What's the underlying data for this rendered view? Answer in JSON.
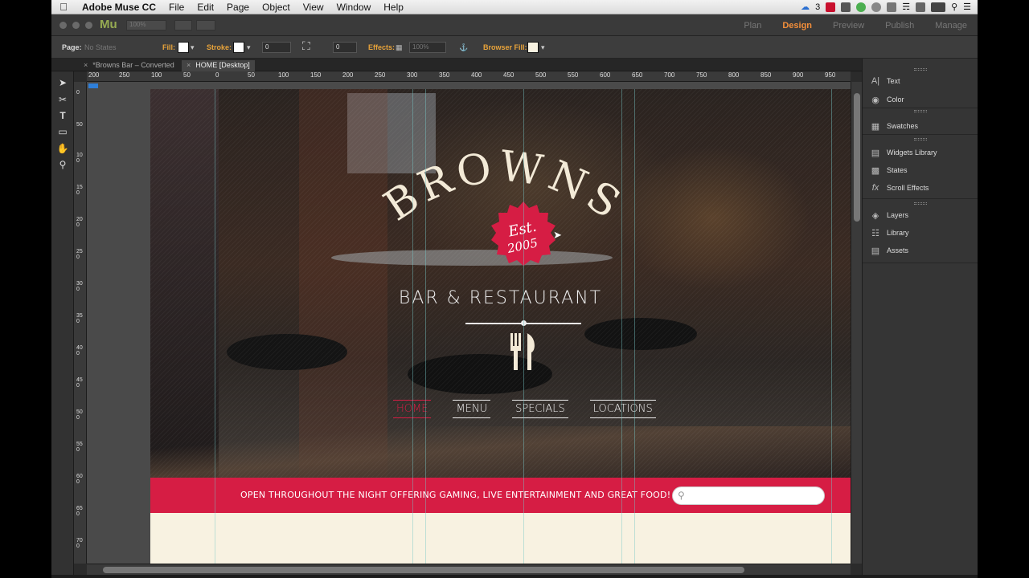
{
  "menubar": {
    "app_name": "Adobe Muse CC",
    "items": [
      "File",
      "Edit",
      "Page",
      "Object",
      "View",
      "Window",
      "Help"
    ],
    "cc_count": "3"
  },
  "titlebar": {
    "logo": "Mu",
    "zoom_value": "100%",
    "modes": [
      "Plan",
      "Design",
      "Preview",
      "Publish",
      "Manage"
    ],
    "active_mode": "Design"
  },
  "controlbar": {
    "page_label": "Page:",
    "page_state": "No States",
    "fill_label": "Fill:",
    "stroke_label": "Stroke:",
    "stroke_value": "0",
    "corner_value": "0",
    "effects_label": "Effects:",
    "opacity_value": "100%",
    "browser_fill_label": "Browser Fill:"
  },
  "tabs": [
    {
      "label": "*Browns Bar – Converted",
      "active": false
    },
    {
      "label": "HOME [Desktop]",
      "active": true
    }
  ],
  "rulers": {
    "h_ticks": [
      "200",
      "250",
      "100",
      "50",
      "0",
      "50",
      "100",
      "150",
      "200",
      "250",
      "300",
      "350",
      "400",
      "450",
      "500",
      "550",
      "600",
      "650",
      "700",
      "750",
      "800",
      "850",
      "900",
      "950"
    ],
    "v_ticks": [
      "0",
      "50",
      "100",
      "150",
      "200",
      "250",
      "300",
      "350",
      "400",
      "450",
      "500",
      "550",
      "600",
      "650",
      "700"
    ]
  },
  "site": {
    "title": "BROWNS",
    "seal_top": "Est.",
    "seal_bottom": "2005",
    "subtitle": "BAR & RESTAURANT",
    "nav": [
      "HOME",
      "MENU",
      "SPECIALS",
      "LOCATIONS"
    ],
    "active_nav": "HOME",
    "tagline": "OPEN THROUGHOUT THE NIGHT OFFERING GAMING, LIVE ENTERTAINMENT AND GREAT FOOD!",
    "colors": {
      "brand_red": "#d61d44",
      "cream": "#f8f2e1"
    }
  },
  "panels": [
    {
      "label": "Text",
      "icon": "text-icon"
    },
    {
      "label": "Color",
      "icon": "palette-icon"
    },
    {
      "label": "Swatches",
      "icon": "swatches-icon"
    },
    {
      "label": "Widgets Library",
      "icon": "widgets-icon"
    },
    {
      "label": "States",
      "icon": "states-icon"
    },
    {
      "label": "Scroll Effects",
      "icon": "fx-icon"
    },
    {
      "label": "Layers",
      "icon": "layers-icon"
    },
    {
      "label": "Library",
      "icon": "library-icon"
    },
    {
      "label": "Assets",
      "icon": "assets-icon"
    }
  ]
}
